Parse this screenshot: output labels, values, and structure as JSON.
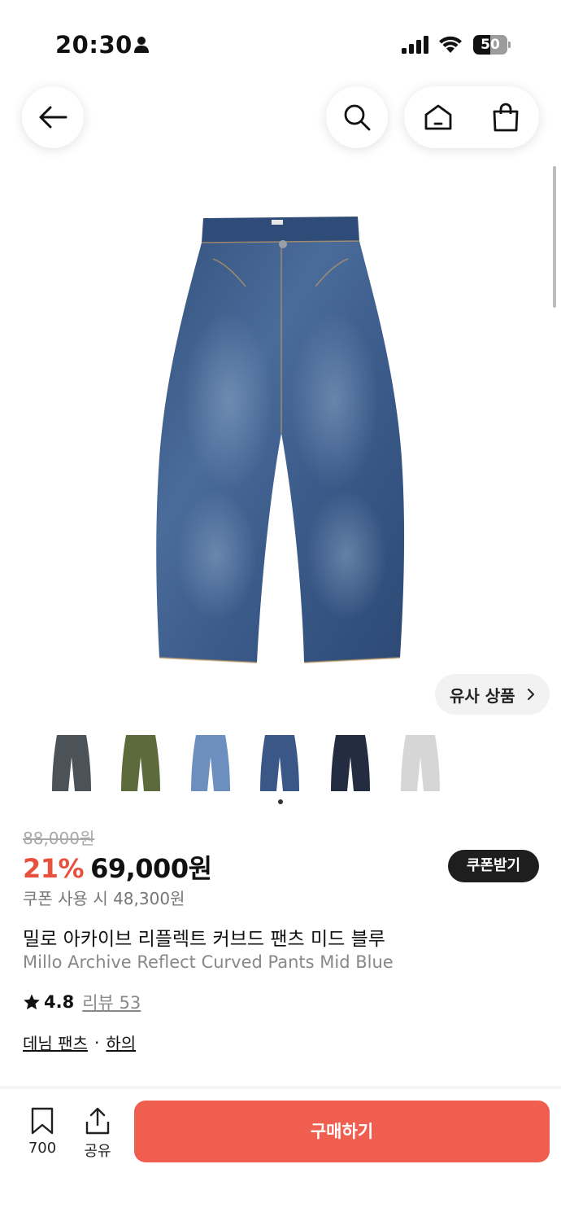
{
  "status_bar": {
    "time": "20:30",
    "battery": "50",
    "battery_level": 0.5
  },
  "nav": {
    "back_icon": "arrow-left-icon",
    "search_icon": "search-icon",
    "home_icon": "home-icon",
    "cart_icon": "shopping-bag-icon"
  },
  "similar": {
    "label": "유사 상품"
  },
  "swatches": [
    {
      "color": "#4b5258"
    },
    {
      "color": "#5d6a3c"
    },
    {
      "color": "#6c8fbf"
    },
    {
      "color": "#3b5788"
    },
    {
      "color": "#232c40"
    },
    {
      "color": "#d6d6d6"
    }
  ],
  "price": {
    "original": "88,000원",
    "discount": "21%",
    "sale": "69,000원",
    "coupon_button": "쿠폰받기",
    "coupon_price": "쿠폰 사용 시 48,300원"
  },
  "product": {
    "name_ko": "밀로 아카이브 리플렉트 커브드 팬츠 미드 블루",
    "name_en": "Millo Archive Reflect Curved Pants Mid Blue",
    "rating": "4.8",
    "review": "리뷰 53",
    "category": "데님 팬츠",
    "category_separator": "·",
    "subcategory": "하의"
  },
  "bottom_bar": {
    "bookmark_count": "700",
    "share_label": "공유",
    "buy_label": "구매하기"
  },
  "colors": {
    "accent": "#e8513c",
    "buy_button": "#ef5e4f",
    "dark": "#1e1e1e"
  }
}
